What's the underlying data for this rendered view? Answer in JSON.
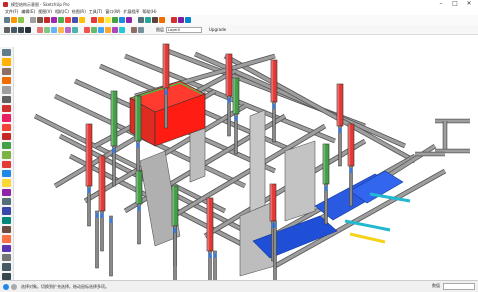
{
  "window": {
    "title": "模型结构示意图 - SketchUp Pro",
    "minimize_icon": "minimize-icon",
    "maximize_icon": "maximize-icon",
    "close_icon": "close-icon"
  },
  "menus": [
    "文件(F)",
    "编辑(E)",
    "视图(V)",
    "相机(C)",
    "绘图(R)",
    "工具(T)",
    "窗口(W)",
    "扩展程序",
    "帮助(H)"
  ],
  "toolbar": {
    "layer_label": "图层",
    "layer_value": "Layer0",
    "update_label": "Upgrade"
  },
  "status": {
    "text": "选择对象。切换到扩充选择。拖动鼠标选择多项。",
    "measure_label": "数值"
  },
  "colors": {
    "steel": "#9e9e9e",
    "red_column": "#e53935",
    "green_column": "#43a047",
    "blue_plate": "#1e4fd6",
    "cyan_rod": "#22b8cf",
    "yellow_rod": "#f5d31a"
  }
}
